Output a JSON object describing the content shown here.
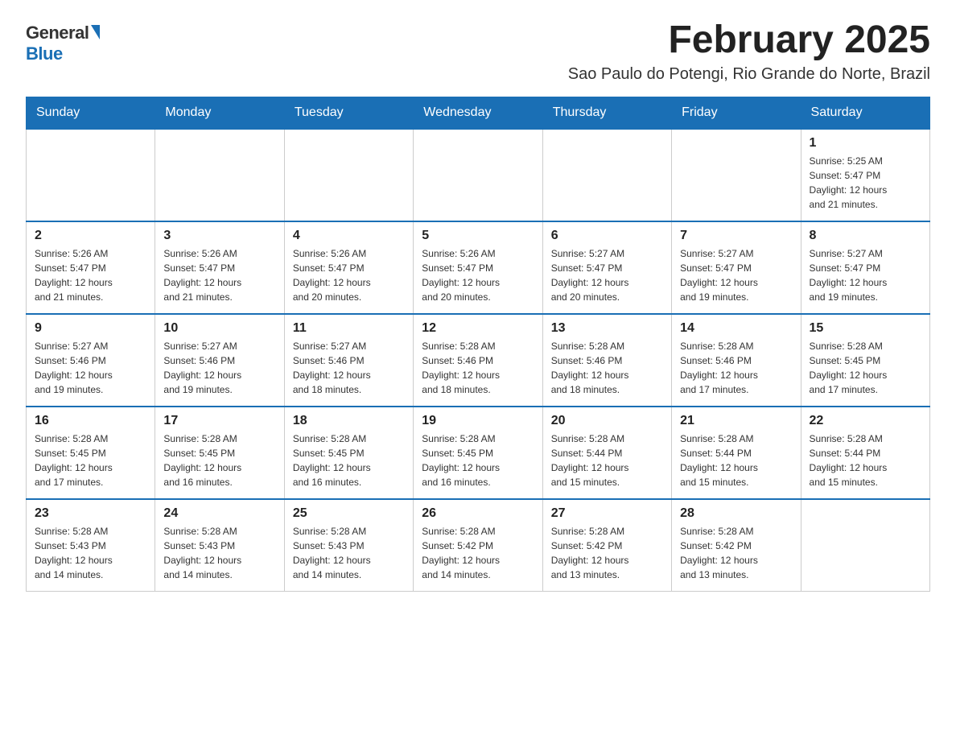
{
  "logo": {
    "general": "General",
    "blue": "Blue"
  },
  "title": "February 2025",
  "location": "Sao Paulo do Potengi, Rio Grande do Norte, Brazil",
  "days_of_week": [
    "Sunday",
    "Monday",
    "Tuesday",
    "Wednesday",
    "Thursday",
    "Friday",
    "Saturday"
  ],
  "weeks": [
    [
      {
        "day": "",
        "info": ""
      },
      {
        "day": "",
        "info": ""
      },
      {
        "day": "",
        "info": ""
      },
      {
        "day": "",
        "info": ""
      },
      {
        "day": "",
        "info": ""
      },
      {
        "day": "",
        "info": ""
      },
      {
        "day": "1",
        "info": "Sunrise: 5:25 AM\nSunset: 5:47 PM\nDaylight: 12 hours\nand 21 minutes."
      }
    ],
    [
      {
        "day": "2",
        "info": "Sunrise: 5:26 AM\nSunset: 5:47 PM\nDaylight: 12 hours\nand 21 minutes."
      },
      {
        "day": "3",
        "info": "Sunrise: 5:26 AM\nSunset: 5:47 PM\nDaylight: 12 hours\nand 21 minutes."
      },
      {
        "day": "4",
        "info": "Sunrise: 5:26 AM\nSunset: 5:47 PM\nDaylight: 12 hours\nand 20 minutes."
      },
      {
        "day": "5",
        "info": "Sunrise: 5:26 AM\nSunset: 5:47 PM\nDaylight: 12 hours\nand 20 minutes."
      },
      {
        "day": "6",
        "info": "Sunrise: 5:27 AM\nSunset: 5:47 PM\nDaylight: 12 hours\nand 20 minutes."
      },
      {
        "day": "7",
        "info": "Sunrise: 5:27 AM\nSunset: 5:47 PM\nDaylight: 12 hours\nand 19 minutes."
      },
      {
        "day": "8",
        "info": "Sunrise: 5:27 AM\nSunset: 5:47 PM\nDaylight: 12 hours\nand 19 minutes."
      }
    ],
    [
      {
        "day": "9",
        "info": "Sunrise: 5:27 AM\nSunset: 5:46 PM\nDaylight: 12 hours\nand 19 minutes."
      },
      {
        "day": "10",
        "info": "Sunrise: 5:27 AM\nSunset: 5:46 PM\nDaylight: 12 hours\nand 19 minutes."
      },
      {
        "day": "11",
        "info": "Sunrise: 5:27 AM\nSunset: 5:46 PM\nDaylight: 12 hours\nand 18 minutes."
      },
      {
        "day": "12",
        "info": "Sunrise: 5:28 AM\nSunset: 5:46 PM\nDaylight: 12 hours\nand 18 minutes."
      },
      {
        "day": "13",
        "info": "Sunrise: 5:28 AM\nSunset: 5:46 PM\nDaylight: 12 hours\nand 18 minutes."
      },
      {
        "day": "14",
        "info": "Sunrise: 5:28 AM\nSunset: 5:46 PM\nDaylight: 12 hours\nand 17 minutes."
      },
      {
        "day": "15",
        "info": "Sunrise: 5:28 AM\nSunset: 5:45 PM\nDaylight: 12 hours\nand 17 minutes."
      }
    ],
    [
      {
        "day": "16",
        "info": "Sunrise: 5:28 AM\nSunset: 5:45 PM\nDaylight: 12 hours\nand 17 minutes."
      },
      {
        "day": "17",
        "info": "Sunrise: 5:28 AM\nSunset: 5:45 PM\nDaylight: 12 hours\nand 16 minutes."
      },
      {
        "day": "18",
        "info": "Sunrise: 5:28 AM\nSunset: 5:45 PM\nDaylight: 12 hours\nand 16 minutes."
      },
      {
        "day": "19",
        "info": "Sunrise: 5:28 AM\nSunset: 5:45 PM\nDaylight: 12 hours\nand 16 minutes."
      },
      {
        "day": "20",
        "info": "Sunrise: 5:28 AM\nSunset: 5:44 PM\nDaylight: 12 hours\nand 15 minutes."
      },
      {
        "day": "21",
        "info": "Sunrise: 5:28 AM\nSunset: 5:44 PM\nDaylight: 12 hours\nand 15 minutes."
      },
      {
        "day": "22",
        "info": "Sunrise: 5:28 AM\nSunset: 5:44 PM\nDaylight: 12 hours\nand 15 minutes."
      }
    ],
    [
      {
        "day": "23",
        "info": "Sunrise: 5:28 AM\nSunset: 5:43 PM\nDaylight: 12 hours\nand 14 minutes."
      },
      {
        "day": "24",
        "info": "Sunrise: 5:28 AM\nSunset: 5:43 PM\nDaylight: 12 hours\nand 14 minutes."
      },
      {
        "day": "25",
        "info": "Sunrise: 5:28 AM\nSunset: 5:43 PM\nDaylight: 12 hours\nand 14 minutes."
      },
      {
        "day": "26",
        "info": "Sunrise: 5:28 AM\nSunset: 5:42 PM\nDaylight: 12 hours\nand 14 minutes."
      },
      {
        "day": "27",
        "info": "Sunrise: 5:28 AM\nSunset: 5:42 PM\nDaylight: 12 hours\nand 13 minutes."
      },
      {
        "day": "28",
        "info": "Sunrise: 5:28 AM\nSunset: 5:42 PM\nDaylight: 12 hours\nand 13 minutes."
      },
      {
        "day": "",
        "info": ""
      }
    ]
  ]
}
